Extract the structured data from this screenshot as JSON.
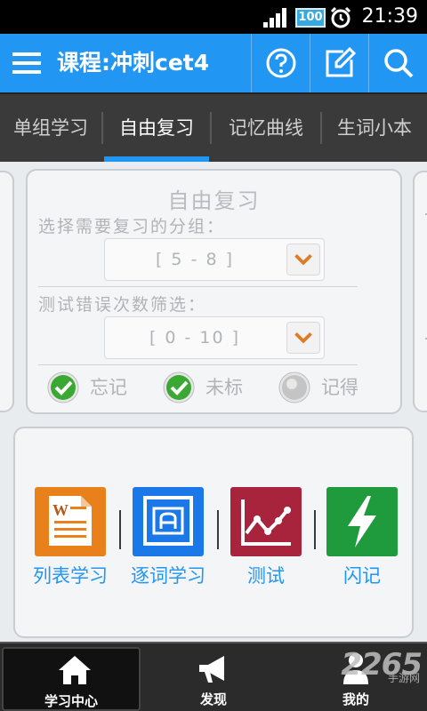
{
  "status": {
    "battery": "100",
    "time": "21:39"
  },
  "appbar": {
    "title": "课程:冲刺cet4"
  },
  "tabs": [
    {
      "label": "单组学习"
    },
    {
      "label": "自由复习"
    },
    {
      "label": "记忆曲线"
    },
    {
      "label": "生词小本"
    }
  ],
  "review": {
    "title": "自由复习",
    "group_label": "选择需要复习的分组：",
    "group_value": "[ 5 - 8 ]",
    "errors_label": "测试错误次数筛选：",
    "errors_value": "[ 0 - 10 ]",
    "options": [
      {
        "label": "忘记",
        "checked": true
      },
      {
        "label": "未标",
        "checked": true
      },
      {
        "label": "记得",
        "checked": false
      }
    ]
  },
  "modes": [
    {
      "label": "列表学习",
      "icon": "word-document-icon",
      "color": "#e8811c"
    },
    {
      "label": "逐词学习",
      "icon": "letter-a-icon",
      "color": "#1a78e8"
    },
    {
      "label": "测试",
      "icon": "line-chart-icon",
      "color": "#a8243d"
    },
    {
      "label": "闪记",
      "icon": "lightning-icon",
      "color": "#1f9a3c"
    }
  ],
  "bottomnav": [
    {
      "label": "学习中心",
      "icon": "home-icon"
    },
    {
      "label": "发现",
      "icon": "megaphone-icon"
    },
    {
      "label": "我的",
      "icon": "user-icon"
    }
  ],
  "watermark": {
    "big": "2265",
    "small": "手游网"
  },
  "colors": {
    "primary": "#2196f3",
    "tab_bg": "#3a3a3a",
    "nav_bg": "#2b2b2b",
    "check_green": "#3aa832",
    "dropdown_arrow": "#e07b25"
  }
}
